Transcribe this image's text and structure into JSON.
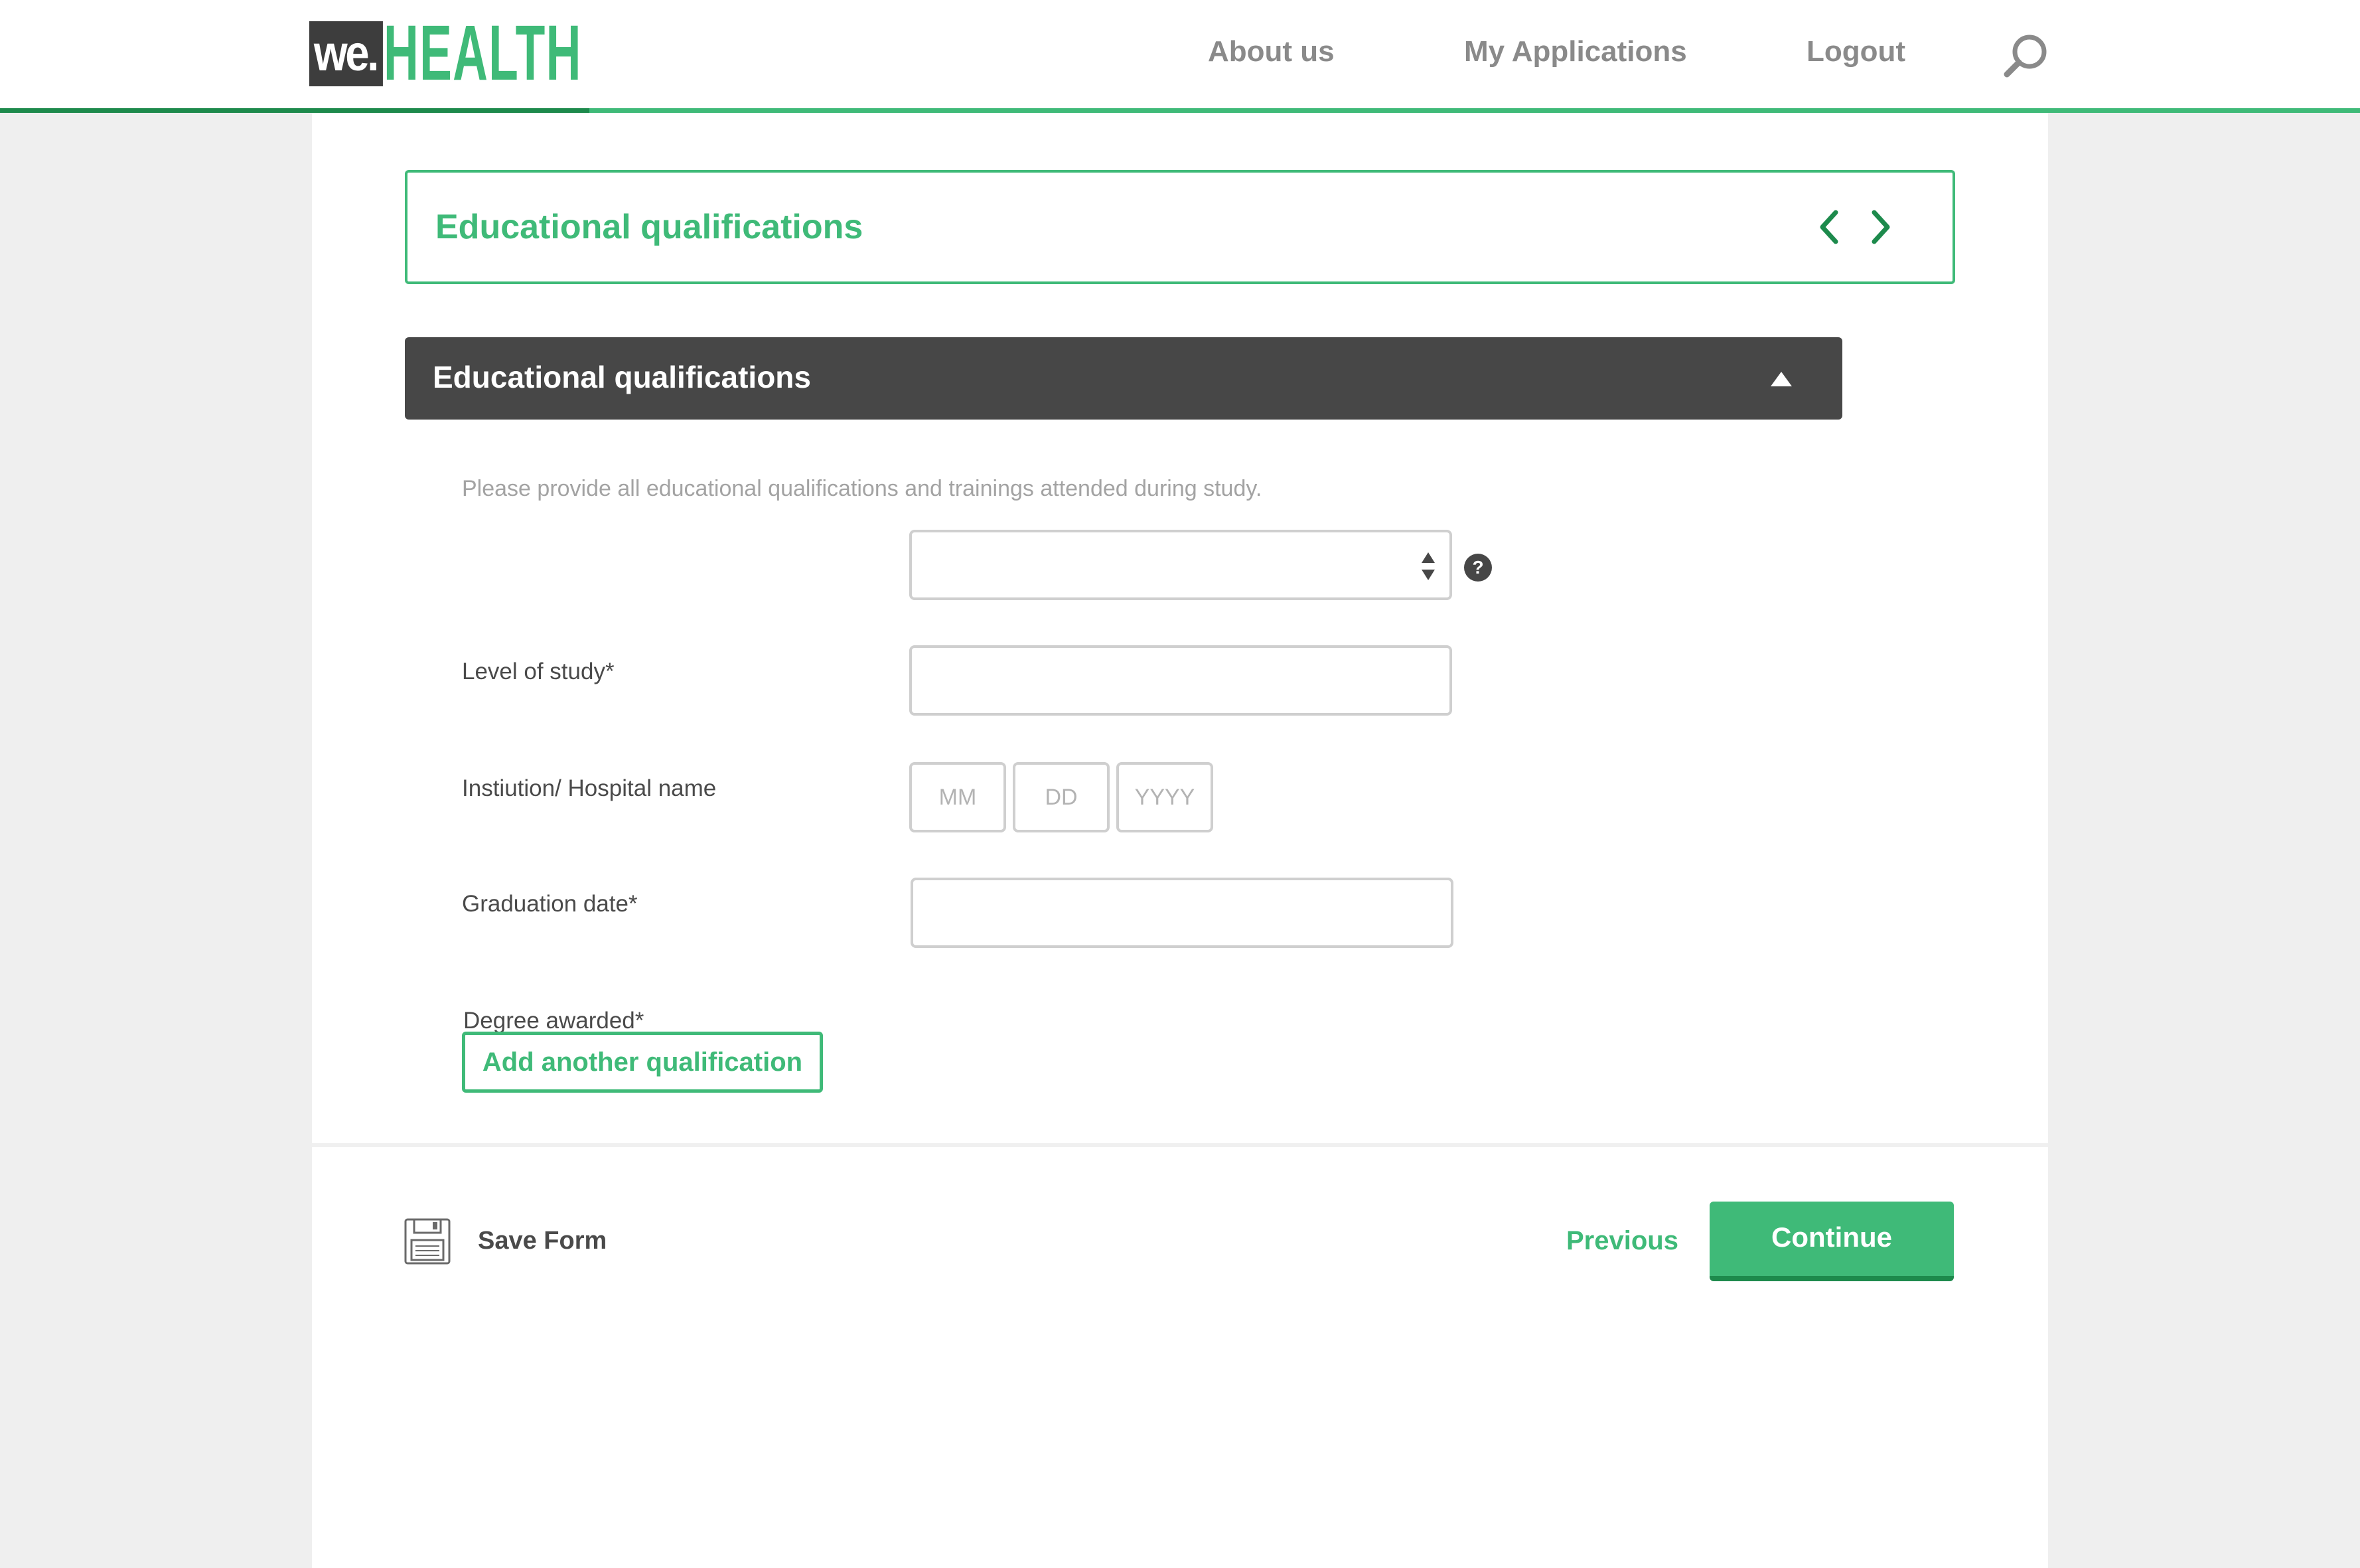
{
  "header": {
    "logo_we": "we.",
    "logo_health": "HEALTH",
    "nav": [
      "About us",
      "My Applications",
      "Logout"
    ],
    "search_icon": "search-icon"
  },
  "section_nav": {
    "title": "Educational qualifications",
    "prev_icon": "chevron-left-icon",
    "next_icon": "chevron-right-icon"
  },
  "accordion": {
    "title": "Educational qualifications",
    "state_icon": "caret-up-icon"
  },
  "form": {
    "intro": "Please provide all educational qualifications and trainings attended during study.",
    "level_of_study": {
      "label": "Level of study*",
      "value": ""
    },
    "institution": {
      "label": "Instiution/ Hospital name",
      "value": ""
    },
    "graduation_date": {
      "label": "Graduation date*",
      "mm_placeholder": "MM",
      "dd_placeholder": "DD",
      "yyyy_placeholder": "YYYY"
    },
    "degree_awarded": {
      "label": "Degree awarded*",
      "value": ""
    },
    "help_glyph": "?",
    "add_label": "Add another qualification"
  },
  "footer": {
    "save_label": "Save Form",
    "save_icon": "floppy-disk-icon",
    "previous_label": "Previous",
    "continue_label": "Continue"
  },
  "colors": {
    "brand_green": "#3fba78",
    "dark_green": "#1d8a4c",
    "dark_gray": "#474747",
    "page_bg": "#efefef"
  }
}
